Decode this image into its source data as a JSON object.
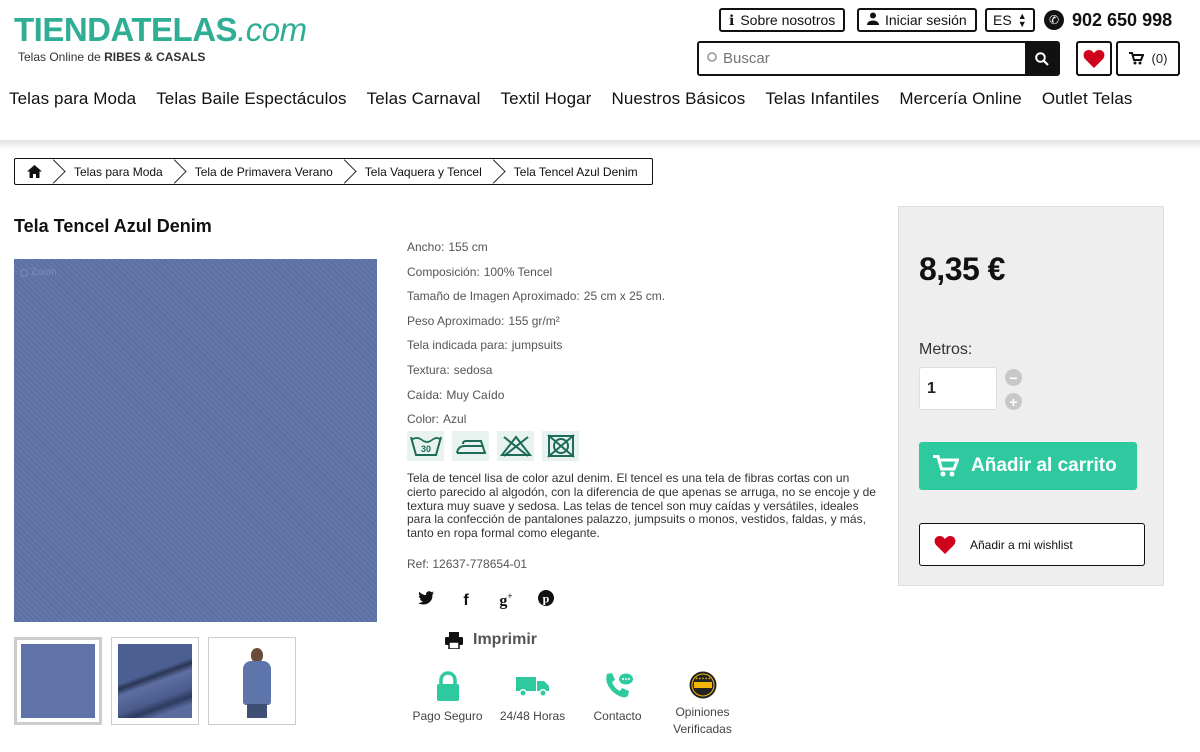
{
  "header": {
    "logo_main": "TIENDATELAS",
    "logo_domain": ".com",
    "logo_tagline_prefix": "Telas Online de",
    "logo_tagline_brand": "RIBES & CASALS",
    "about_label": "Sobre nosotros",
    "login_label": "Iniciar sesión",
    "language": "ES",
    "phone": "902 650 998",
    "search_placeholder": "Buscar",
    "cart_count": "(0)"
  },
  "nav": {
    "items": [
      {
        "label": "Telas para Moda"
      },
      {
        "label": "Telas Baile Espectáculos"
      },
      {
        "label": "Telas Carnaval"
      },
      {
        "label": "Textil Hogar"
      },
      {
        "label": "Nuestros Básicos"
      },
      {
        "label": "Telas Infantiles"
      },
      {
        "label": "Mercería Online"
      },
      {
        "label": "Outlet Telas"
      }
    ]
  },
  "breadcrumb": {
    "items": [
      {
        "label": "Telas para Moda"
      },
      {
        "label": "Tela de Primavera Verano"
      },
      {
        "label": "Tela Vaquera y Tencel"
      },
      {
        "label": "Tela Tencel Azul Denim"
      }
    ]
  },
  "product": {
    "title": "Tela Tencel Azul Denim",
    "zoom_label": "Zoom",
    "image_color": "#5f73a8",
    "specs": [
      {
        "key": "Ancho:",
        "value": "155 cm"
      },
      {
        "key": "Composición:",
        "value": "100% Tencel"
      },
      {
        "key": "Tamaño de Imagen Aproximado:",
        "value": "25 cm x 25 cm."
      },
      {
        "key": "Peso Aproximado:",
        "value": "155 gr/m²"
      },
      {
        "key": "Tela indicada para:",
        "value": "jumpsuits"
      },
      {
        "key": "Textura:",
        "value": "sedosa"
      },
      {
        "key": "Caída:",
        "value": "Muy Caído"
      },
      {
        "key": "Color:",
        "value": "Azul"
      }
    ],
    "care_icons": [
      "wash-30-icon",
      "iron-icon",
      "no-bleach-icon",
      "no-tumble-dry-icon"
    ],
    "care_wash_temp": "30",
    "description": "Tela de tencel lisa de color azul denim. El tencel es una tela de fibras cortas con un cierto parecido al algodón, con la diferencia de que apenas se arruga, no se encoje y de textura muy suave y sedosa. Las telas de tencel son muy caídas y versátiles, ideales para la confección de pantalones palazzo, jumpsuits o monos, vestidos, faldas, y más, tanto en ropa formal como elegante.",
    "reference": "Ref: 12637-778654-01",
    "print_label": "Imprimir"
  },
  "features": [
    {
      "label": "Pago Seguro",
      "icon": "padlock-icon"
    },
    {
      "label": "24/48 Horas",
      "icon": "delivery-truck-icon"
    },
    {
      "label": "Contacto",
      "icon": "phone-chat-icon"
    },
    {
      "label": "Opiniones Verificadas",
      "icon": "verified-reviews-badge-icon"
    }
  ],
  "buybox": {
    "price": "8,35 €",
    "quantity_label": "Metros:",
    "quantity": "1",
    "add_to_cart": "Añadir al carrito",
    "add_to_wishlist": "Añadir a mi wishlist"
  },
  "colors": {
    "brand": "#2fae95",
    "cart_button": "#2fc9a0",
    "wishlist_heart": "#d0021b"
  }
}
